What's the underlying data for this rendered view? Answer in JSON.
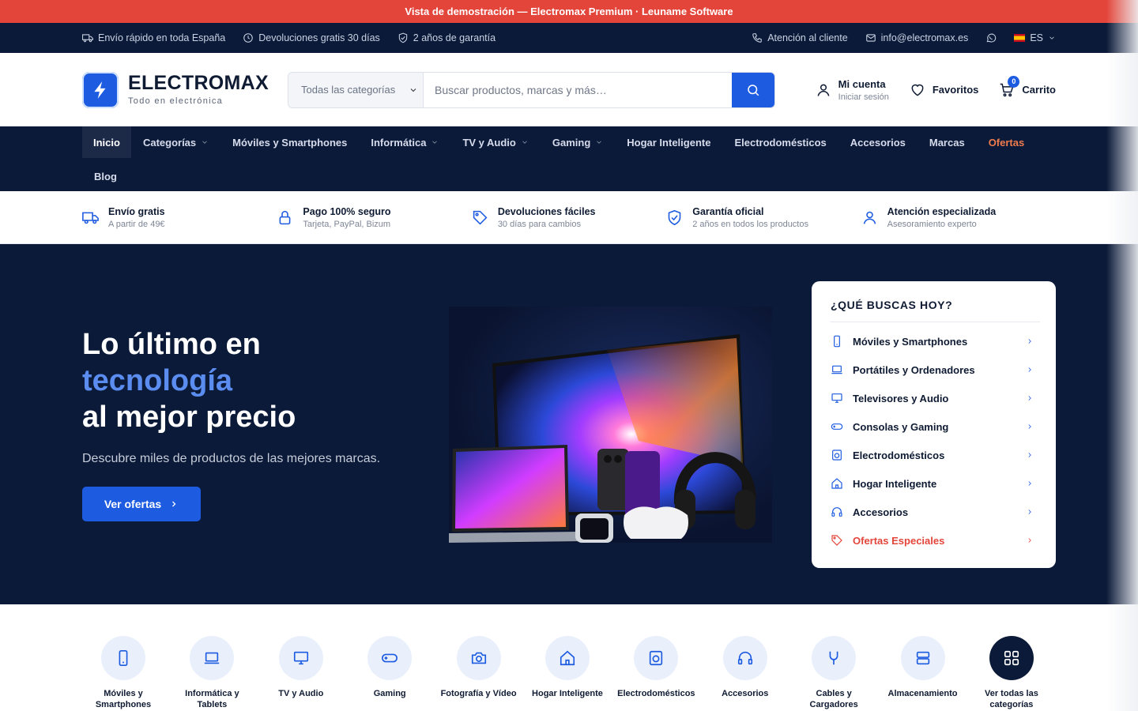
{
  "demo_bar": "Vista de demostración — Electromax Premium · Leuname Software",
  "topbar": {
    "left": [
      "Envío rápido en toda España",
      "Devoluciones gratis 30 días",
      "2 años de garantía"
    ],
    "support": "Atención al cliente",
    "email": "info@electromax.es",
    "lang": "ES"
  },
  "brand": {
    "name": "ELECTROMAX",
    "tagline": "Todo en electrónica",
    "color": "#1d5be0"
  },
  "search": {
    "category": "Todas las categorías",
    "placeholder": "Buscar productos, marcas y más…"
  },
  "account": {
    "title": "Mi cuenta",
    "sub": "Iniciar sesión"
  },
  "favorites": "Favoritos",
  "cart": {
    "label": "Carrito",
    "count": "0"
  },
  "nav": {
    "items": [
      "Inicio",
      "Categorías",
      "Móviles y Smartphones",
      "Informática",
      "TV y Audio",
      "Gaming",
      "Hogar Inteligente",
      "Electrodomésticos",
      "Accesorios",
      "Marcas",
      "Ofertas",
      "Blog"
    ]
  },
  "trust": [
    {
      "title": "Envío gratis",
      "sub": "A partir de 49€",
      "icon": "truck-icon"
    },
    {
      "title": "Pago 100% seguro",
      "sub": "Tarjeta, PayPal, Bizum",
      "icon": "lock-icon"
    },
    {
      "title": "Devoluciones fáciles",
      "sub": "30 días para cambios",
      "icon": "tag-icon"
    },
    {
      "title": "Garantía oficial",
      "sub": "2 años en todos los productos",
      "icon": "shield-icon"
    },
    {
      "title": "Atención especializada",
      "sub": "Asesoramiento experto",
      "icon": "user-icon"
    }
  ],
  "hero": {
    "line1": "Lo último en",
    "highlight": "tecnología",
    "line3": "al mejor precio",
    "subtitle": "Descubre miles de productos de las mejores marcas.",
    "cta": "Ver ofertas"
  },
  "panel": {
    "title": "¿QUÉ BUSCAS HOY?",
    "items": [
      "Móviles y Smartphones",
      "Portátiles y Ordenadores",
      "Televisores y Audio",
      "Consolas y Gaming",
      "Electrodomésticos",
      "Hogar Inteligente",
      "Accesorios",
      "Ofertas Especiales"
    ]
  },
  "categories": [
    "Móviles y Smartphones",
    "Informática y Tablets",
    "TV y Audio",
    "Gaming",
    "Fotografía y Vídeo",
    "Hogar Inteligente",
    "Electrodomésticos",
    "Accesorios",
    "Cables y Cargadores",
    "Almacenamiento",
    "Ver todas las categorías"
  ]
}
